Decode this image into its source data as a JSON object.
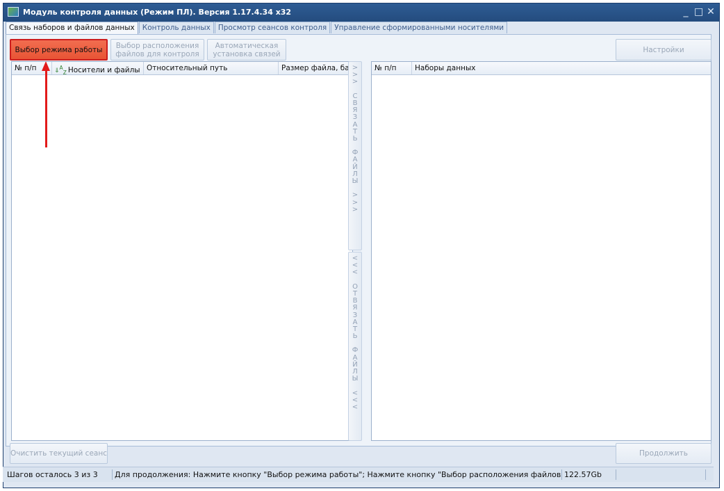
{
  "window": {
    "title": "Модуль контроля данных (Режим ПЛ). Версия 1.17.4.34 x32",
    "minimize_glyph": "_",
    "maximize_glyph": "□",
    "close_glyph": "✕"
  },
  "tabs": [
    {
      "label": "Связь наборов и файлов данных",
      "active": true
    },
    {
      "label": "Контроль данных",
      "active": false
    },
    {
      "label": "Просмотр сеансов контроля",
      "active": false
    },
    {
      "label": "Управление сформированными носителями",
      "active": false
    }
  ],
  "toolbar": {
    "mode_button": "Выбор режима работы",
    "location_button_line1": "Выбор расположения",
    "location_button_line2": "файлов для контроля",
    "auto_button_line1": "Автоматическая",
    "auto_button_line2": "установка связей",
    "settings_button": "Настройки"
  },
  "left_grid": {
    "columns": [
      "№ п/п",
      "Носители и файлы",
      "Относительный путь",
      "Размер файла, байт"
    ],
    "sort_icon": "sort-az-icon",
    "rows": []
  },
  "link_button": {
    "chars": [
      ">",
      ">",
      ">",
      "",
      "С",
      "В",
      "Я",
      "З",
      "А",
      "Т",
      "Ь",
      "",
      "Ф",
      "А",
      "Й",
      "Л",
      "Ы",
      "",
      ">",
      ">",
      ">"
    ]
  },
  "unlink_button": {
    "chars": [
      "<",
      "<",
      "<",
      "",
      "О",
      "Т",
      "В",
      "Я",
      "З",
      "А",
      "Т",
      "Ь",
      "",
      "Ф",
      "А",
      "Й",
      "Л",
      "Ы",
      "",
      "<",
      "<",
      "<"
    ]
  },
  "right_grid": {
    "columns": [
      "№ п/п",
      "Наборы данных"
    ],
    "rows": []
  },
  "bottom": {
    "clear_button": "Очистить текущий сеанс",
    "continue_button": "Продолжить"
  },
  "status": {
    "steps": "Шагов осталось 3 из 3",
    "hint": "Для продолжения: Нажмите кнопку \"Выбор режима работы\"; Нажмите кнопку \"Выбор расположения файлов для контро",
    "size": "122.57Gb"
  },
  "colors": {
    "titlebar": "#2e5c94",
    "primary_button": "#e85435",
    "annotation_arrow": "#e21a1a"
  }
}
